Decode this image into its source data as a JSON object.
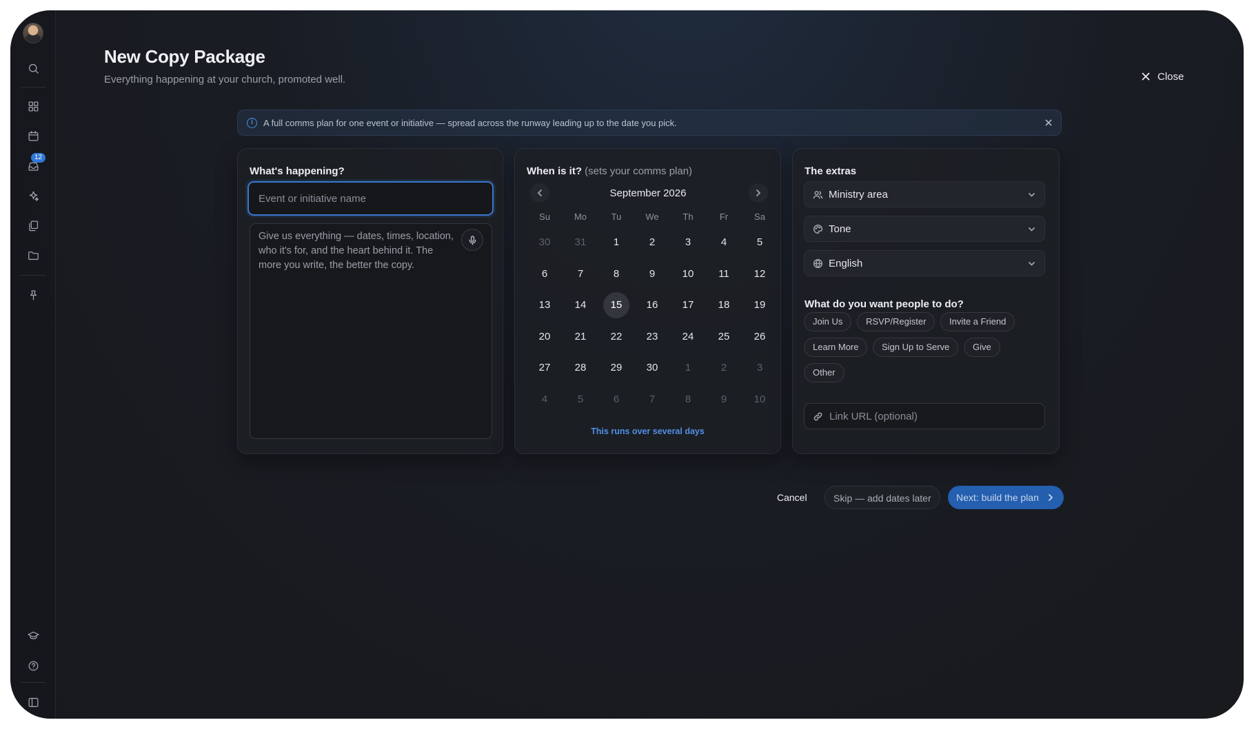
{
  "page": {
    "title": "New Copy Package",
    "subtitle": "Everything happening at your church, promoted well.",
    "close_label": "Close"
  },
  "sidebar": {
    "items": [
      {
        "name": "search-icon"
      },
      {
        "name": "dashboard-icon"
      },
      {
        "name": "calendar-icon"
      },
      {
        "name": "inbox-icon",
        "badge": "12"
      },
      {
        "name": "sparkles-icon"
      },
      {
        "name": "copy-icon"
      },
      {
        "name": "folder-icon"
      },
      {
        "name": "pin-icon"
      },
      {
        "name": "graduation-cap-icon"
      },
      {
        "name": "help-icon"
      },
      {
        "name": "sidebar-toggle-icon"
      }
    ]
  },
  "info": {
    "message": "A full comms plan for one event or initiative — spread across the runway leading up to the date you pick."
  },
  "happening": {
    "heading": "What's happening?",
    "name_placeholder": "Event or initiative name",
    "desc_placeholder": "Give us everything — dates, times, location, who it's for, and the heart behind it. The more you write, the better the copy."
  },
  "when": {
    "heading": "When is it?",
    "heading_note": "(sets your comms plan)",
    "month_label": "September 2026",
    "weekdays": [
      "Su",
      "Mo",
      "Tu",
      "We",
      "Th",
      "Fr",
      "Sa"
    ],
    "days": [
      {
        "d": "30",
        "out": true
      },
      {
        "d": "31",
        "out": true
      },
      {
        "d": "1"
      },
      {
        "d": "2"
      },
      {
        "d": "3"
      },
      {
        "d": "4"
      },
      {
        "d": "5"
      },
      {
        "d": "6"
      },
      {
        "d": "7"
      },
      {
        "d": "8"
      },
      {
        "d": "9"
      },
      {
        "d": "10"
      },
      {
        "d": "11"
      },
      {
        "d": "12"
      },
      {
        "d": "13"
      },
      {
        "d": "14"
      },
      {
        "d": "15",
        "selected": true
      },
      {
        "d": "16"
      },
      {
        "d": "17"
      },
      {
        "d": "18"
      },
      {
        "d": "19"
      },
      {
        "d": "20"
      },
      {
        "d": "21"
      },
      {
        "d": "22"
      },
      {
        "d": "23"
      },
      {
        "d": "24"
      },
      {
        "d": "25"
      },
      {
        "d": "26"
      },
      {
        "d": "27"
      },
      {
        "d": "28"
      },
      {
        "d": "29"
      },
      {
        "d": "30"
      },
      {
        "d": "1",
        "out": true
      },
      {
        "d": "2",
        "out": true
      },
      {
        "d": "3",
        "out": true
      },
      {
        "d": "4",
        "out": true
      },
      {
        "d": "5",
        "out": true
      },
      {
        "d": "6",
        "out": true
      },
      {
        "d": "7",
        "out": true
      },
      {
        "d": "8",
        "out": true
      },
      {
        "d": "9",
        "out": true
      },
      {
        "d": "10",
        "out": true
      }
    ],
    "multiday_link": "This runs over several days"
  },
  "extras": {
    "heading": "The extras",
    "ministry_label": "Ministry area",
    "tone_label": "Tone",
    "language_label": "English",
    "cta_heading": "What do you want people to do?",
    "ctas": [
      "Join Us",
      "RSVP/Register",
      "Invite a Friend",
      "Learn More",
      "Sign Up to Serve",
      "Give",
      "Other"
    ],
    "url_placeholder": "Link URL (optional)"
  },
  "footer": {
    "cancel": "Cancel",
    "skip": "Skip — add dates later",
    "next": "Next: build the plan"
  },
  "colors": {
    "accent": "#3b78cf",
    "primary_button": "#245fb0",
    "badge": "#2f78d6",
    "link": "#4f90e6"
  }
}
